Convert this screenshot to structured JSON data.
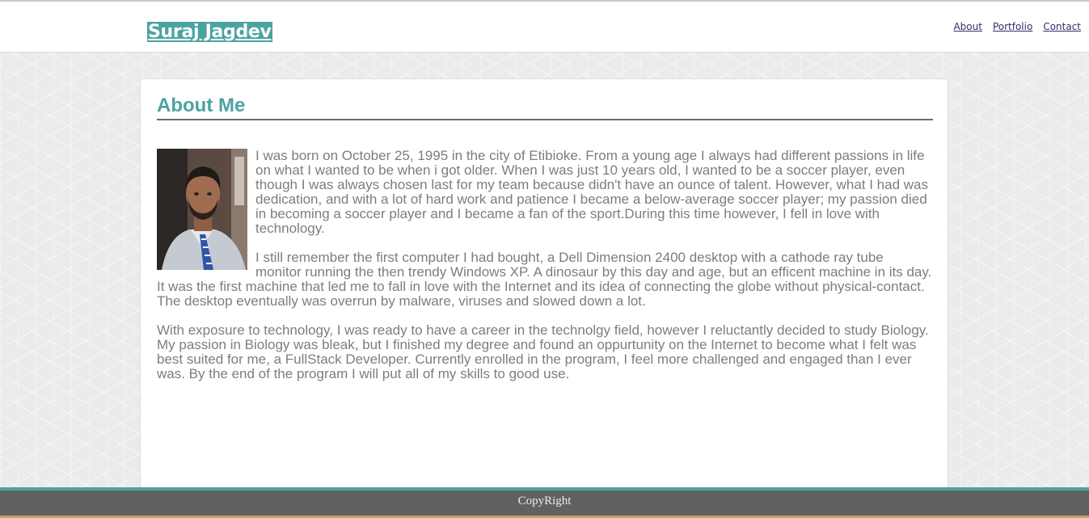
{
  "site": {
    "brand": "Suraj Jagdev"
  },
  "nav": {
    "items": [
      {
        "label": "About"
      },
      {
        "label": "Portfolio"
      },
      {
        "label": "Contact"
      }
    ]
  },
  "about": {
    "title": "About Me",
    "paragraphs": [
      "I was born on October 25, 1995 in the city of Etibioke. From a young age I always had different passions in life on what I wanted to be when i got older. When I was just 10 years old, I wanted to be a soccer player, even though I was always chosen last for my team because didn't have an ounce of talent. However, what I had was dedication, and with a lot of hard work and patience I became a below-average soccer player; my passion died in becoming a soccer player and I became a fan of the sport.During this time however, I fell in love with technology.",
      "I still remember the first computer I had bought, a Dell Dimension 2400 desktop with a cathode ray tube monitor running the then trendy Windows XP. A dinosaur by this day and age, but an efficent machine in its day. It was the first machine that led me to fall in love with the Internet and its idea of connecting the globe without physical-contact. The desktop eventually was overrun by malware, viruses and slowed down a lot.",
      "With exposure to technology, I was ready to have a career in the technolgy field, however I reluctantly decided to study Biology. My passion in Biology was bleak, but I finished my degree and found an oppurtunity on the Internet to become what I felt was best suited for me, a FullStack Developer. Currently enrolled in the program, I feel more challenged and engaged than I ever was. By the end of the program I will put all of my skills to good use."
    ]
  },
  "footer": {
    "text": "CopyRight"
  },
  "colors": {
    "accent": "#4ba3a0",
    "nav_link": "#3a2a6a",
    "body_text": "#7d7d7d",
    "footer_bg": "#616161"
  }
}
